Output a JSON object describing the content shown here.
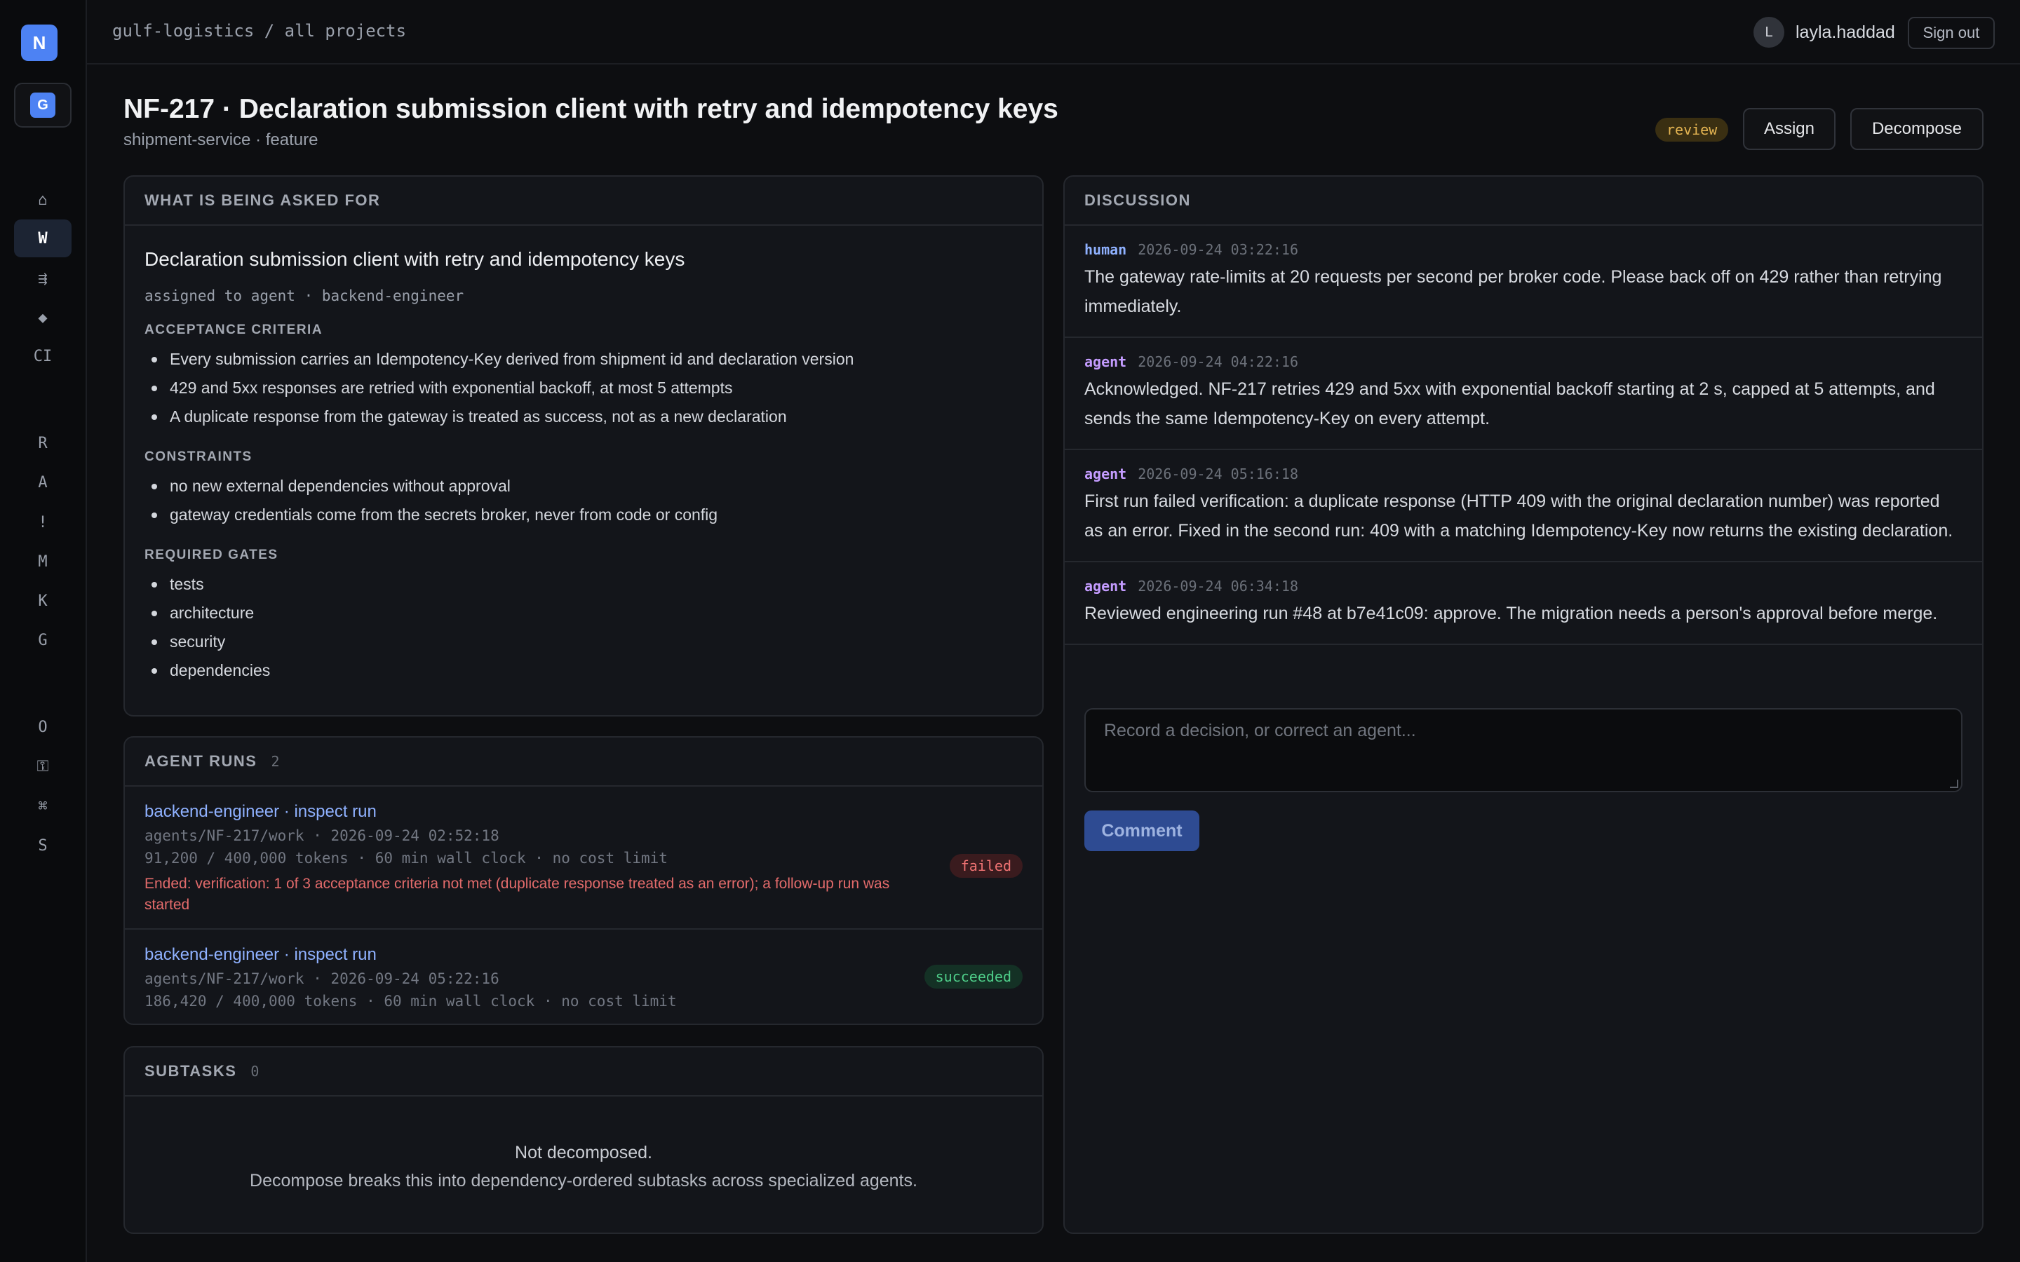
{
  "app": {
    "logo_letter": "N",
    "workspace_letter": "G"
  },
  "rail": {
    "items": [
      {
        "glyph": "⌂",
        "name": "home"
      },
      {
        "glyph": "W",
        "name": "work"
      },
      {
        "glyph": "⇶",
        "name": "pipeline"
      },
      {
        "glyph": "◆",
        "name": "diamond"
      },
      {
        "glyph": "CI",
        "name": "ci"
      },
      {
        "glyph": "R",
        "name": "r"
      },
      {
        "glyph": "A",
        "name": "a"
      },
      {
        "glyph": "!",
        "name": "alerts"
      },
      {
        "glyph": "M",
        "name": "m"
      },
      {
        "glyph": "K",
        "name": "k"
      },
      {
        "glyph": "G",
        "name": "g"
      },
      {
        "glyph": "O",
        "name": "o"
      },
      {
        "glyph": "⚿",
        "name": "key"
      },
      {
        "glyph": "⌘",
        "name": "command"
      },
      {
        "glyph": "S",
        "name": "s"
      }
    ]
  },
  "topbar": {
    "breadcrumb": "gulf-logistics / all projects",
    "avatar_letter": "L",
    "username": "layla.haddad",
    "signout_label": "Sign out"
  },
  "header": {
    "title": "NF-217 · Declaration submission client with retry and idempotency keys",
    "subtitle": "shipment-service · feature",
    "status": "review",
    "assign_label": "Assign",
    "decompose_label": "Decompose"
  },
  "ask": {
    "heading": "WHAT IS BEING ASKED FOR",
    "title": "Declaration submission client with retry and idempotency keys",
    "assigned": "assigned to agent · backend-engineer",
    "acceptance_label": "ACCEPTANCE CRITERIA",
    "acceptance": [
      "Every submission carries an Idempotency-Key derived from shipment id and declaration version",
      "429 and 5xx responses are retried with exponential backoff, at most 5 attempts",
      "A duplicate response from the gateway is treated as success, not as a new declaration"
    ],
    "constraints_label": "CONSTRAINTS",
    "constraints": [
      "no new external dependencies without approval",
      "gateway credentials come from the secrets broker, never from code or config"
    ],
    "gates_label": "REQUIRED GATES",
    "gates": [
      "tests",
      "architecture",
      "security",
      "dependencies"
    ]
  },
  "runs": {
    "heading": "AGENT RUNS",
    "count": "2",
    "items": [
      {
        "link": "backend-engineer · inspect run",
        "branch": "agents/NF-217/work · 2026-09-24 02:52:18",
        "budget": "91,200 / 400,000 tokens · 60 min wall clock · no cost limit",
        "error": "Ended: verification: 1 of 3 acceptance criteria not met (duplicate response treated as an error); a follow-up run was started",
        "status": "failed"
      },
      {
        "link": "backend-engineer · inspect run",
        "branch": "agents/NF-217/work · 2026-09-24 05:22:16",
        "budget": "186,420 / 400,000 tokens · 60 min wall clock · no cost limit",
        "status": "succeeded"
      }
    ]
  },
  "subtasks": {
    "heading": "SUBTASKS",
    "count": "0",
    "empty_line1": "Not decomposed.",
    "empty_line2": "Decompose breaks this into dependency-ordered subtasks across specialized agents."
  },
  "discussion": {
    "heading": "DISCUSSION",
    "messages": [
      {
        "author": "human",
        "time": "2026-09-24 03:22:16",
        "text": "The gateway rate-limits at 20 requests per second per broker code. Please back off on 429 rather than retrying immediately."
      },
      {
        "author": "agent",
        "time": "2026-09-24 04:22:16",
        "text": "Acknowledged. NF-217 retries 429 and 5xx with exponential backoff starting at 2 s, capped at 5 attempts, and sends the same Idempotency-Key on every attempt."
      },
      {
        "author": "agent",
        "time": "2026-09-24 05:16:18",
        "text": "First run failed verification: a duplicate response (HTTP 409 with the original declaration number) was reported as an error. Fixed in the second run: 409 with a matching Idempotency-Key now returns the existing declaration."
      },
      {
        "author": "agent",
        "time": "2026-09-24 06:34:18",
        "text": "Reviewed engineering run #48 at b7e41c09: approve. The migration needs a person's approval before merge."
      }
    ],
    "composer_placeholder": "Record a decision, or correct an agent...",
    "comment_label": "Comment"
  },
  "colors": {
    "accent": "#4d82f3",
    "link": "#8fb1ff",
    "review": "#e5b552",
    "failed": "#f07373",
    "succeeded": "#4fcf8a"
  }
}
